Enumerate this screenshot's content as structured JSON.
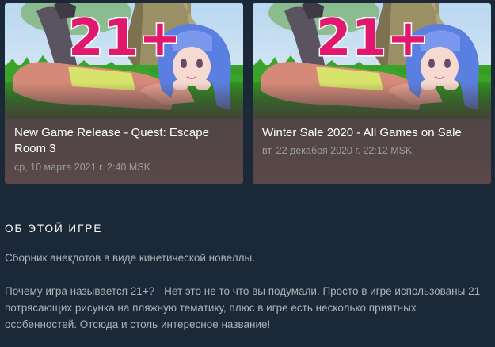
{
  "events": [
    {
      "title": "New Game Release - Quest: Escape Room 3",
      "date": "ср, 10 марта 2021 г. 2:40 MSK",
      "badge": "21+"
    },
    {
      "title": "Winter Sale 2020 - All Games on Sale",
      "date": "вт, 22 декабря 2020 г. 22:12 MSK",
      "badge": "21+"
    }
  ],
  "about": {
    "heading": "Об этой игре",
    "paragraphs": [
      "Сборник анекдотов в виде кинетической новеллы.",
      "Почему игра называется 21+? - Нет это не то что вы подумали. Просто в игре использованы 21 потрясающих рисунка на пляжную тематику, плюс в игре есть несколько приятных особенностей. Отсюда и столь интересное название!"
    ]
  },
  "colors": {
    "page_bg": "#1b2838",
    "badge_pink": "#e0196f",
    "grass": "#2f8a1e",
    "hair_blue": "#5a7fe0"
  }
}
